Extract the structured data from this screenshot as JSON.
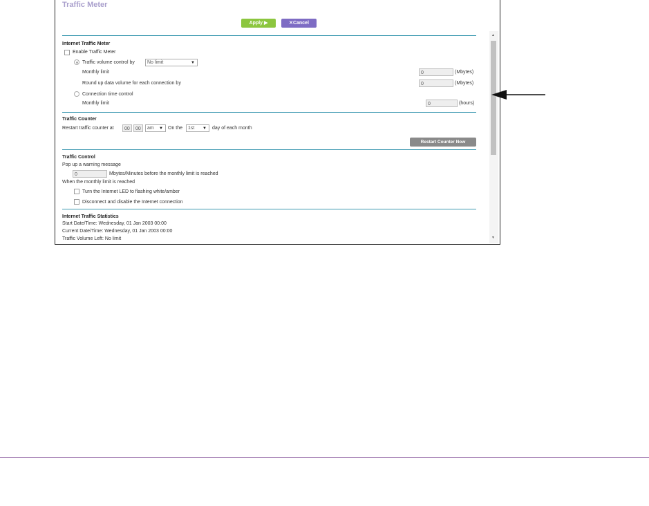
{
  "page": {
    "title": "Traffic Meter"
  },
  "buttons": {
    "apply": "Apply ▶",
    "cancel": "✕Cancel",
    "restart": "Restart Counter Now"
  },
  "internet_traffic_meter": {
    "heading": "Internet Traffic Meter",
    "enable_label": "Enable Traffic Meter",
    "volume_control_label": "Traffic volume control by",
    "volume_control_value": "No limit",
    "monthly_limit_label": "Monthly limit",
    "monthly_limit_value": "0",
    "monthly_limit_unit": "(Mbytes)",
    "roundup_label": "Round up data volume for each connection by",
    "roundup_value": "0",
    "roundup_unit": "(Mbytes)",
    "connection_time_label": "Connection time control",
    "time_limit_label": "Monthly limit",
    "time_limit_value": "0",
    "time_limit_unit": "(hours)"
  },
  "traffic_counter": {
    "heading": "Traffic Counter",
    "restart_label": "Restart traffic counter at",
    "hour": "00",
    "minute": "00",
    "ampm": "am",
    "on_the": "On the",
    "day": "1st",
    "day_suffix": "day of each month"
  },
  "traffic_control": {
    "heading": "Traffic Control",
    "popup_label": "Pop up a warning message",
    "popup_value": "0",
    "popup_suffix": "Mbytes/Minutes before the monthly limit is reached",
    "when_label": "When the monthly limit is reached",
    "led_label": "Turn the Internet LED to flashing white/amber",
    "disconnect_label": "Disconnect and disable the Internet connection"
  },
  "statistics": {
    "heading": "Internet Traffic Statistics",
    "start": "Start Date/Time: Wednesday, 01 Jan 2003 00:00",
    "current": "Current Date/Time: Wednesday, 01 Jan 2003 00:00",
    "volume_left": "Traffic Volume Left: No limit"
  },
  "colors": {
    "apply": "#8cc63f",
    "cancel": "#7e6cc4",
    "rule": "#3a98b0",
    "title": "#a99fcc"
  }
}
